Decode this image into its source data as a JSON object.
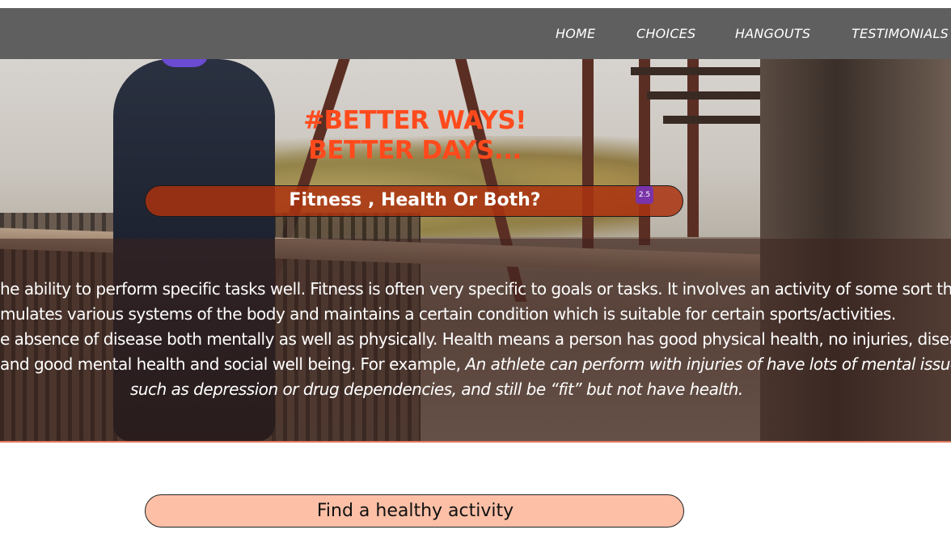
{
  "nav": {
    "items": [
      {
        "label": "HOME"
      },
      {
        "label": "CHOICES"
      },
      {
        "label": "HANGOUTS"
      },
      {
        "label": "TESTIMONIALS"
      }
    ]
  },
  "hero": {
    "headline_1": "#BETTER WAYS!",
    "headline_2": "BETTER DAYS...",
    "question_pill": "Fitness , Health Or Both?",
    "badge": "2.5",
    "paragraph_lines": [
      "he ability to perform specific tasks well. Fitness is often very specific to goals or tasks. It involves an activity of some sort that",
      "mulates various systems of the body and maintains a certain condition which is suitable for certain sports/activities.",
      "e absence of disease both mentally as well as physically. Health means a person has good physical health, no injuries, diseases",
      "and good mental health and social well being. For example, "
    ],
    "italic_line_4": "An athlete can perform with injuries of have lots of mental issues",
    "italic_line_5": "such as depression or drug dependencies, and still be “fit” but not have health."
  },
  "cta": {
    "label": "Find a healthy activity"
  },
  "colors": {
    "nav_bg": "#5f5f5f",
    "headline": "#ff4a1c",
    "cta_bg": "#fdc0a7"
  }
}
